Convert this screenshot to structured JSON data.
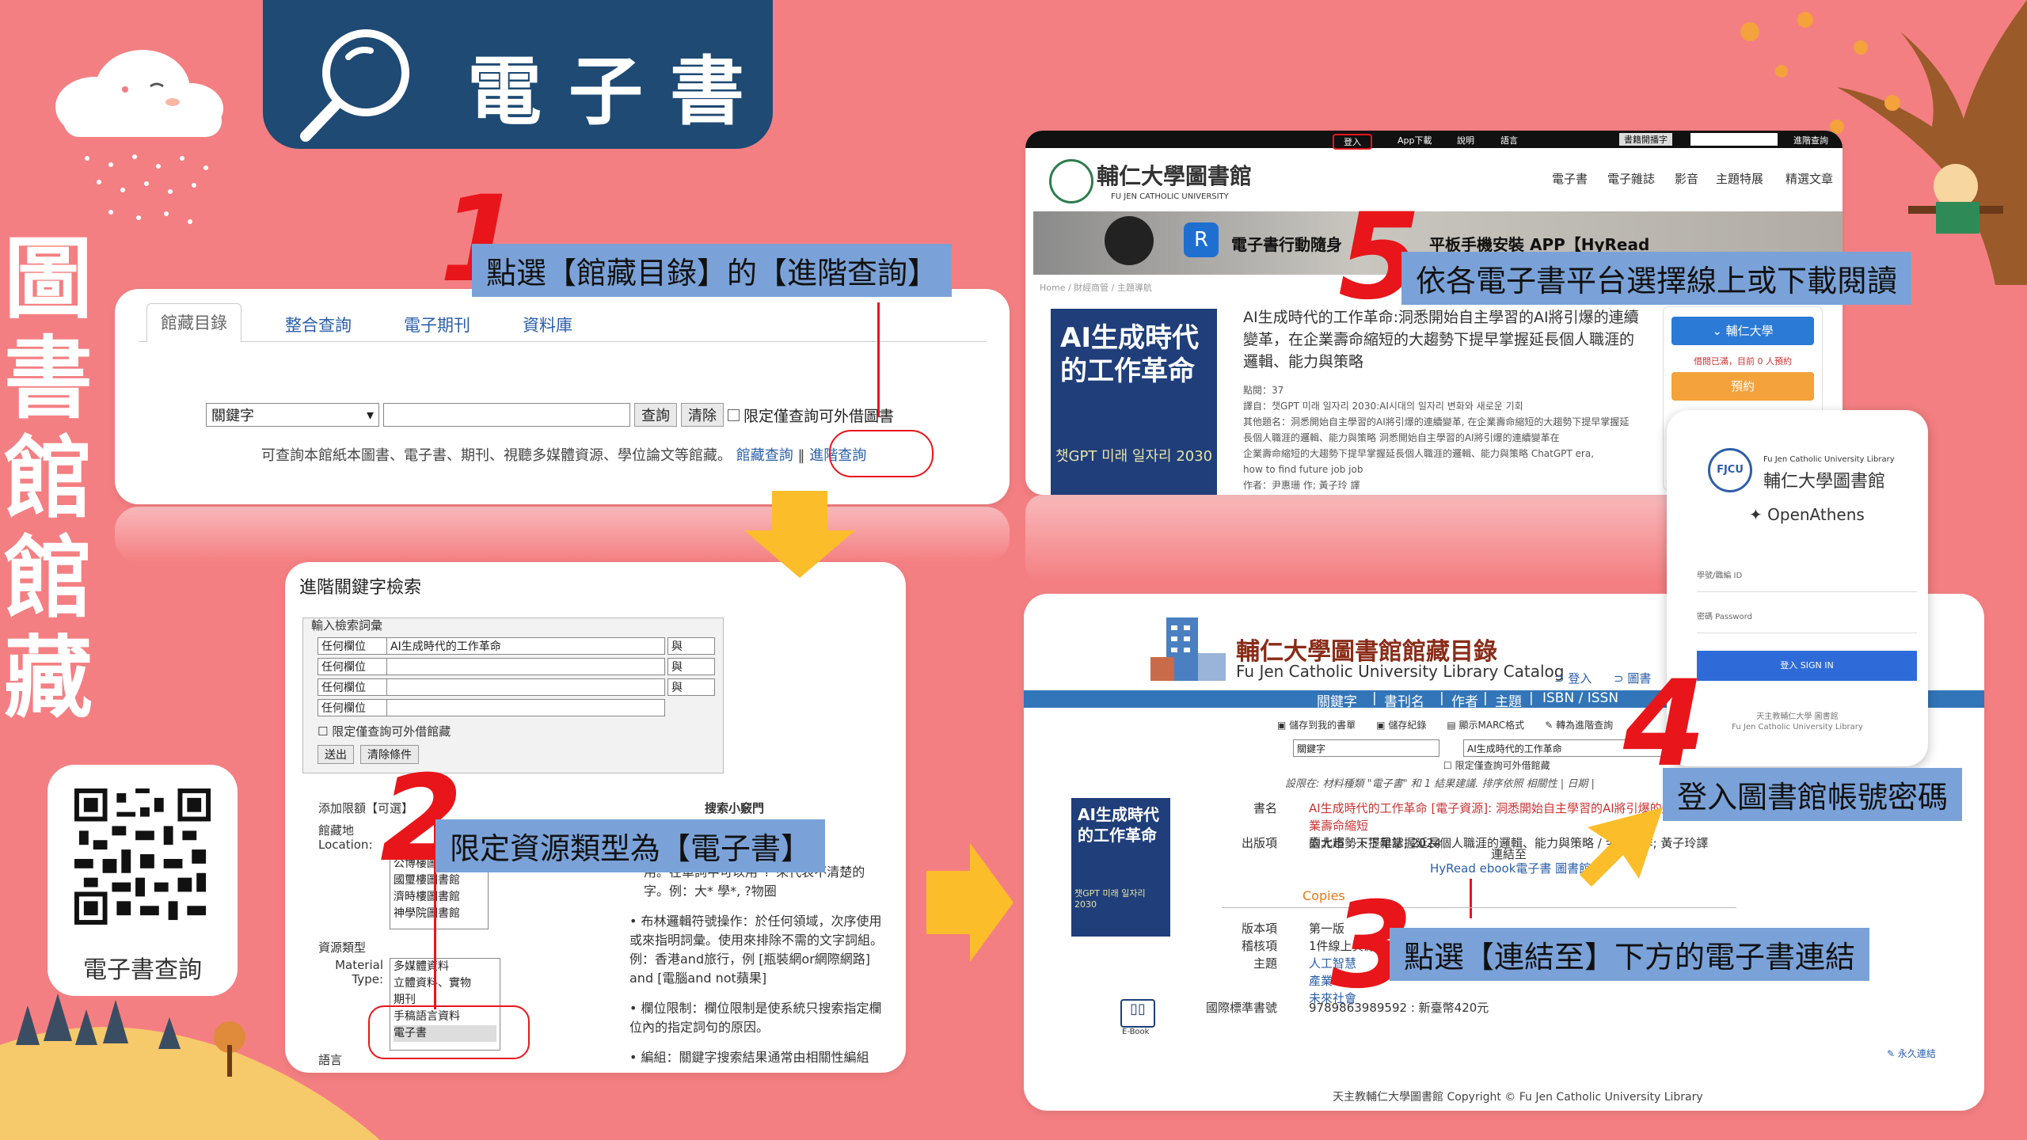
{
  "header": {
    "title": "電子書"
  },
  "side_title": "圖書館館藏",
  "qr": {
    "label": "電子書查詢"
  },
  "steps": [
    {
      "num": "1",
      "text": "點選【館藏目錄】的【進階查詢】"
    },
    {
      "num": "2",
      "text": "限定資源類型為【電子書】"
    },
    {
      "num": "3",
      "text": "點選【連結至】下方的電子書連結"
    },
    {
      "num": "4",
      "text": "登入圖書館帳號密碼"
    },
    {
      "num": "5",
      "text": "依各電子書平台選擇線上或下載閱讀"
    }
  ],
  "panel1": {
    "tabs": [
      "館藏目錄",
      "整合查詢",
      "電子期刊",
      "資料庫"
    ],
    "select_value": "關鍵字",
    "search_btn": "查詢",
    "clear_btn": "清除",
    "checkbox_label": "限定僅查詢可外借圖書",
    "hint": "可查詢本館紙本圖書、電子書、期刊、視聽多媒體資源、學位論文等館藏。",
    "link_catalog": "館藏查詢",
    "link_advanced": "進階查詢"
  },
  "panel2": {
    "title": "進階關鍵字檢索",
    "fieldset_label": "輸入檢索詞彙",
    "field_select": "任何欄位",
    "query": "AI生成時代的工作革命",
    "bool_and": "與",
    "limit_checkbox": "限定僅查詢可外借館藏",
    "submit": "送出",
    "reset": "清除條件",
    "limits_label": "添加限額【可選】",
    "location_label": "館藏地 Location:",
    "locations": [
      "公博樓圖書館",
      "國璽樓圖書館",
      "濟時樓圖書館",
      "神學院圖書館"
    ],
    "material_label": "資源類型",
    "material_label_en": "Material Type:",
    "materials": [
      "多媒體資料",
      "立體資料、實物",
      "期刊",
      "手稿語言資料",
      "電子書"
    ],
    "language_label": "語言",
    "search_tips_title": "搜索小竅門",
    "tips": [
      "用。在單詞中可以用\"?\"來代表不清楚的字。例：大* 學*, ?物圈",
      "布林邏輯符號操作：於任何領域，次序使用或來指明詞彙。使用來排除不需的文字詞組。例：香港and旅行，例 [瓶裝網or網際網路] and [電腦and not蘋果]",
      "欄位限制：欄位限制是使系統只搜索指定欄位內的指定詞句的原因。",
      "編組：關鍵字搜索結果通常由相關性編組"
    ]
  },
  "panel3": {
    "topbar": [
      "登入",
      "App下載",
      "說明",
      "語言",
      "書籍開播字",
      "進階查詢"
    ],
    "logo_title": "輔仁大學圖書館",
    "logo_sub": "FU JEN CATHOLIC UNIVERSITY",
    "menu": [
      "電子書",
      "電子雜誌",
      "影音",
      "主題特展",
      "精選文章"
    ],
    "banner_text": "電子書行動隨身",
    "banner_text2": "平板手機安裝 APP【HyRead",
    "breadcrumb": "Home / 財經商管 / 主題導航",
    "book_title": "AI生成時代的工作革命:洞悉開始自主學習的AI將引爆的連續變革，在企業壽命縮短的大趨勢下提早掌握延長個人職涯的邏輯、能力與策略",
    "meta": [
      "點閱：37",
      "譯自：챗GPT 미래 일자리 2030:AI시대의 일자리 변화와 새로운 기회",
      "其他題名：洞悉開始自主學習的AI將引爆的連續變革, 在企業壽命縮短的大趨勢下提早掌握延長個人職涯的邏輯、能力與策略 洞悉開始自主學習的AI將引爆的連續變革在",
      "企業壽命縮短的大趨勢下提早掌握延長個人職涯的邏輯、能力與策略 ChatGPT era,",
      "how to find future job job",
      "作者：尹惠珊 作; 黃子玲 譯"
    ],
    "cover_title": "AI生成時代的工作革命",
    "cover_sub": "챗GPT 미래 일자리 2030",
    "side_btn": "輔仁大學",
    "status": "借閱已滿，目前 0 人預約",
    "reserve": "預約"
  },
  "panel4": {
    "catalog_title": "輔仁大學圖書館館藏目錄",
    "catalog_sub": "Fu Jen Catholic University Library Catalog",
    "login_link": "登入",
    "lib_link": "圖書",
    "nav": [
      "關鍵字",
      "書刊名",
      "作者",
      "主題",
      "ISBN / ISSN"
    ],
    "toolbar": [
      "儲存到我的書單",
      "儲存紀錄",
      "顯示MARC格式",
      "轉為進階查詢"
    ],
    "search_select": "關鍵字",
    "search_value": "AI生成時代的工作革命",
    "limit_check": "限定僅查詢可外借館藏",
    "result_line": "設限在: 材料種類 \"電子書\" 和 1 結果建議. 排序依照 相關性 | 日期 |",
    "title_label": "書名",
    "title_value": "AI生成時代的工作革命 [電子資源]: 洞悉開始自主學習的AI將引爆的連續變革，在企業壽命縮短",
    "title_value2": "的大趨勢下提早掌握延長個人職涯的邏輯、能力與策略 / 尹惠珊作; 黃子玲譯",
    "pub_label": "出版項",
    "pub_value": "臺北市 : 天下雜誌, 2024",
    "link_to": "連結至",
    "hyread": "HyRead ebook電子書 圖書館",
    "copies": "Copies",
    "edition_label": "版本項",
    "edition_value": "第一版",
    "format_label": "稽核項",
    "format_value": "1件線上資源",
    "subject_label": "主題",
    "subject_values": [
      "人工智慧",
      "產業",
      "未來社會"
    ],
    "isbn_label": "國際標準書號",
    "isbn_value": "9789863989592 : 新臺幣420元",
    "ebook_icon_label": "E-Book",
    "permalink": "永久連結",
    "footer": "天主教輔仁大學圖書館 Copyright © Fu Jen Catholic University Library"
  },
  "panel5": {
    "logo_small": "Fu Jen Catholic University Library",
    "logo_name": "輔仁大學圖書館",
    "provider": "OpenAthens",
    "id_label": "學號/職編 ID",
    "pw_label": "密碼 Password",
    "signin": "登入 SIGN IN",
    "foot1": "天主教輔仁大學 圖書館",
    "foot2": "Fu Jen Catholic University Library"
  },
  "colors": {
    "background": "#f47f82",
    "header": "#1e4a73",
    "step_bg": "#7aa2d8",
    "step_num": "#e8151b",
    "arrow": "#fbbd2a"
  }
}
